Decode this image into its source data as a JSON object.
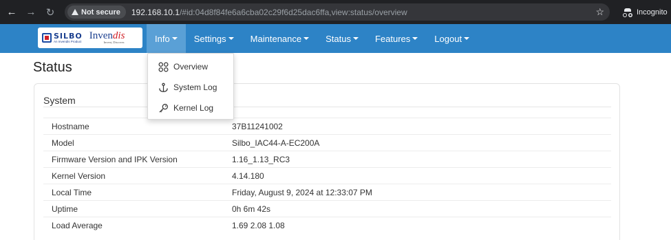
{
  "browser": {
    "security_label": "Not secure",
    "url_host": "192.168.10.1",
    "url_rest": "/#id:04d8f84fe6a6cba02c29f6d25dac6ffa,view:status/overview",
    "incognito_label": "Incognito"
  },
  "brand": {
    "silbo_name": "SILBO",
    "silbo_sub": "An Invendis Product",
    "invendis_prefix": "Inven",
    "invendis_suffix": "dis",
    "invendis_tagline": "Invent, Discover."
  },
  "menu": {
    "items": [
      {
        "label": "Info"
      },
      {
        "label": "Settings"
      },
      {
        "label": "Maintenance"
      },
      {
        "label": "Status"
      },
      {
        "label": "Features"
      },
      {
        "label": "Logout"
      }
    ]
  },
  "info_dropdown": {
    "items": [
      {
        "label": "Overview",
        "icon": "grid-icon"
      },
      {
        "label": "System Log",
        "icon": "anchor-icon"
      },
      {
        "label": "Kernel Log",
        "icon": "key-icon"
      }
    ]
  },
  "page": {
    "title": "Status",
    "panel_title": "System",
    "rows": [
      {
        "key": "Hostname",
        "value": "37B11241002"
      },
      {
        "key": "Model",
        "value": "Silbo_IAC44-A-EC200A"
      },
      {
        "key": "Firmware Version and IPK Version",
        "value": "1.16_1.13_RC3"
      },
      {
        "key": "Kernel Version",
        "value": "4.14.180"
      },
      {
        "key": "Local Time",
        "value": "Friday, August 9, 2024 at 12:33:07 PM"
      },
      {
        "key": "Uptime",
        "value": "0h 6m 42s"
      },
      {
        "key": "Load Average",
        "value": "1.69 2.08 1.08"
      }
    ]
  },
  "colors": {
    "navbar": "#2d83c6",
    "navbar_active": "#5aa0d6",
    "chrome": "#202124"
  }
}
